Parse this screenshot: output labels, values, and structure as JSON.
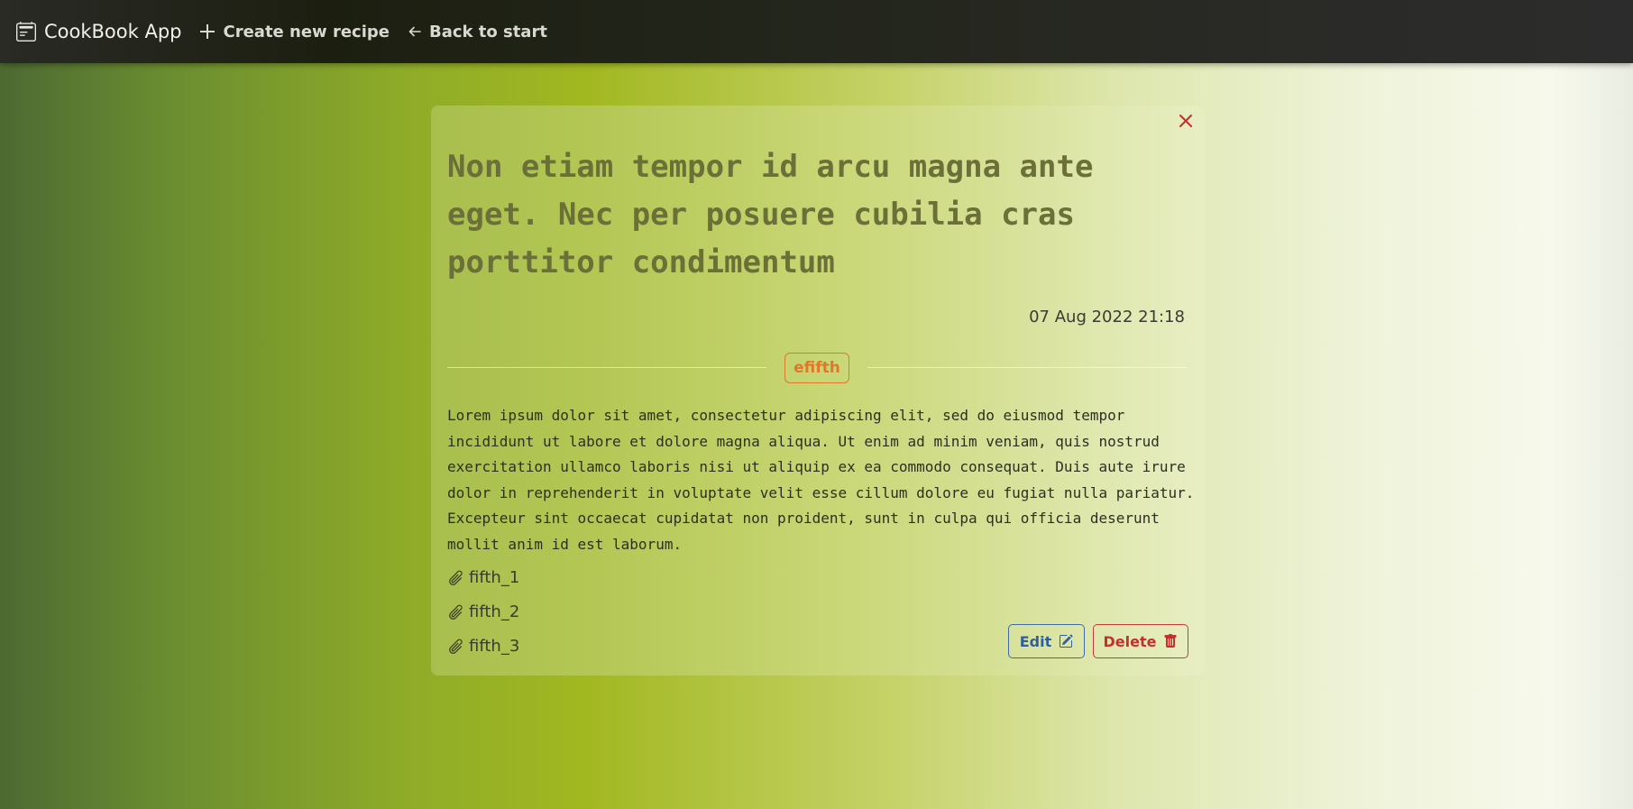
{
  "navbar": {
    "brand": "CookBook App",
    "create_label": "Create new recipe",
    "back_label": "Back to start"
  },
  "recipe": {
    "title": "Non etiam tempor id arcu magna ante eget. Nec per posuere cubilia cras porttitor condimentum",
    "date": "07 Aug 2022 21:18",
    "tag": "efifth",
    "description": "Lorem ipsum dolor sit amet, consectetur adipiscing elit, sed do eiusmod tempor incididunt ut labore et dolore magna aliqua. Ut enim ad minim veniam, quis nostrud exercitation ullamco laboris nisi ut aliquip ex ea commodo consequat. Duis aute irure dolor in reprehenderit in voluptate velit esse cillum dolore eu fugiat nulla pariatur. Excepteur sint occaecat cupidatat non proident, sunt in culpa qui officia deserunt mollit anim id est laborum.",
    "attachments": [
      "fifth_1",
      "fifth_2",
      "fifth_3"
    ]
  },
  "actions": {
    "edit_label": "Edit",
    "delete_label": "Delete"
  },
  "colors": {
    "tag": "#e0782c",
    "edit": "#2f5f9f",
    "delete": "#c33030",
    "close": "#c33030"
  },
  "icons": {
    "brand": "calendar-icon",
    "create": "plus-icon",
    "back": "arrow-left-icon",
    "close": "close-icon",
    "attachment": "paperclip-icon",
    "edit": "pencil-square-icon",
    "delete": "trash-icon"
  }
}
